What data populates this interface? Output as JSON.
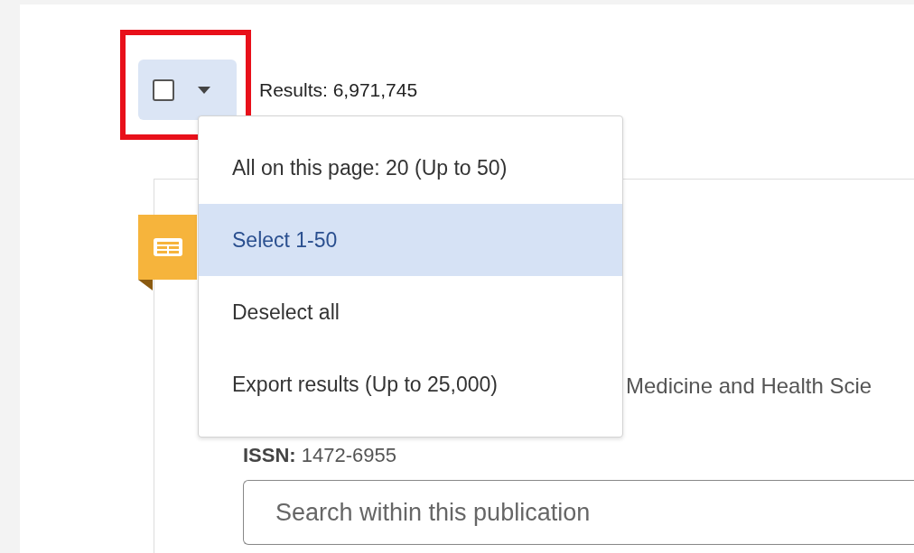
{
  "selector": {
    "checked": false,
    "expanded": true,
    "highlighted": true
  },
  "results": "Results: 6,971,745",
  "menu": [
    {
      "label": "All on this page: 20 (Up to 50)",
      "selected": false
    },
    {
      "label": "Select 1-50",
      "selected": true
    },
    {
      "label": "Deselect all",
      "selected": false
    },
    {
      "label": "Export results (Up to 25,000)",
      "selected": false
    }
  ],
  "publication": {
    "subject": "Medicine and Health Scie",
    "issn_label": "ISSN:",
    "issn": "1472-6955"
  },
  "search": {
    "placeholder": "Search within this publication"
  }
}
